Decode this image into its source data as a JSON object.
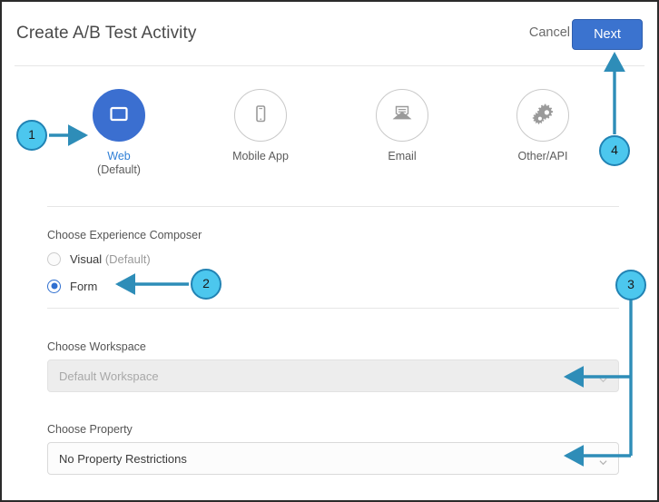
{
  "header": {
    "title": "Create A/B Test Activity",
    "cancel_label": "Cancel",
    "next_label": "Next"
  },
  "channels": [
    {
      "id": "web",
      "label": "Web",
      "sublabel": "(Default)",
      "icon": "monitor-icon",
      "selected": true
    },
    {
      "id": "mobile",
      "label": "Mobile App",
      "sublabel": "",
      "icon": "phone-icon",
      "selected": false
    },
    {
      "id": "email",
      "label": "Email",
      "sublabel": "",
      "icon": "envelope-icon",
      "selected": false
    },
    {
      "id": "other",
      "label": "Other/API",
      "sublabel": "",
      "icon": "gears-icon",
      "selected": false
    }
  ],
  "composer": {
    "section_label": "Choose Experience Composer",
    "options": [
      {
        "id": "visual",
        "label": "Visual",
        "suffix": "(Default)",
        "selected": false
      },
      {
        "id": "form",
        "label": "Form",
        "suffix": "",
        "selected": true
      }
    ]
  },
  "workspace": {
    "label": "Choose Workspace",
    "value": "Default Workspace",
    "disabled": true,
    "chevron": "chevron-down-icon"
  },
  "property": {
    "label": "Choose Property",
    "value": "No Property Restrictions",
    "disabled": false,
    "chevron": "chevron-down-icon"
  },
  "annotations": [
    {
      "id": 1,
      "number": "1",
      "points_to": "web-channel-option"
    },
    {
      "id": 2,
      "number": "2",
      "points_to": "form-radio-option"
    },
    {
      "id": 3,
      "number": "3",
      "points_to": "workspace-and-property-dropdowns"
    },
    {
      "id": 4,
      "number": "4",
      "points_to": "next-button"
    }
  ],
  "colors": {
    "accent_blue": "#3b6fd0",
    "next_button": "#3b73cf",
    "link_blue": "#2f7fd6",
    "annotation_fill": "#4cc7ee",
    "annotation_stroke": "#2183b4",
    "arrow": "#2e8db8",
    "icon_grey": "#9a9a9a"
  }
}
